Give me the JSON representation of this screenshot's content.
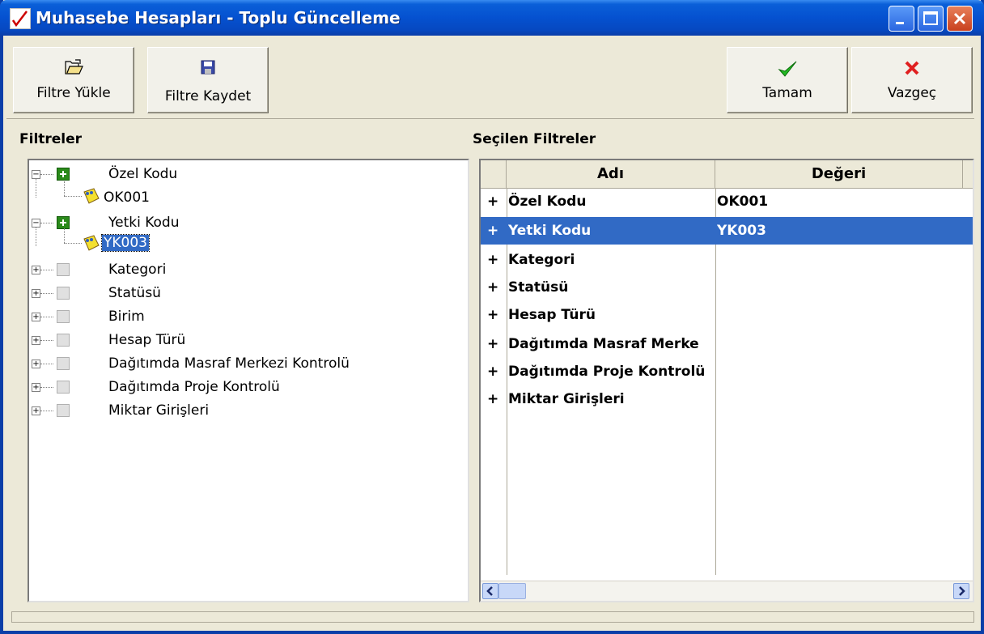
{
  "window": {
    "title": "Muhasebe Hesapları - Toplu Güncelleme",
    "accent": "#0a5fd8",
    "selection_color": "#316ac5"
  },
  "toolbar": {
    "load_filter_label": "Filtre Yükle",
    "save_filter_label": "Filtre Kaydet",
    "ok_label": "Tamam",
    "cancel_label": "Vazgeç"
  },
  "filters_panel": {
    "title": "Filtreler",
    "tree": [
      {
        "label": "Özel Kodu",
        "expanded": true,
        "checked": true,
        "children": [
          "OK001"
        ]
      },
      {
        "label": "Yetki Kodu",
        "expanded": true,
        "checked": true,
        "children": [
          "YK003"
        ]
      },
      {
        "label": "Kategori",
        "expanded": false,
        "checked": false
      },
      {
        "label": "Statüsü",
        "expanded": false,
        "checked": false
      },
      {
        "label": "Birim",
        "expanded": false,
        "checked": false
      },
      {
        "label": "Hesap Türü",
        "expanded": false,
        "checked": false
      },
      {
        "label": "Dağıtımda Masraf Merkezi Kontrolü",
        "expanded": false,
        "checked": false
      },
      {
        "label": "Dağıtımda Proje Kontrolü",
        "expanded": false,
        "checked": false
      },
      {
        "label": "Miktar Girişleri",
        "expanded": false,
        "checked": false
      }
    ]
  },
  "selected_panel": {
    "title": "Seçilen Filtreler",
    "columns": [
      "Adı",
      "Değeri"
    ],
    "rows": [
      {
        "expander": "+",
        "name": "Özel Kodu",
        "value": "OK001"
      },
      {
        "expander": "+",
        "name": "Yetki Kodu",
        "value": "YK003"
      },
      {
        "expander": "+",
        "name": "Kategori",
        "value": ""
      },
      {
        "expander": "+",
        "name": "Statüsü",
        "value": ""
      },
      {
        "expander": "+",
        "name": "Hesap Türü",
        "value": ""
      },
      {
        "expander": "+",
        "name": "Dağıtımda Masraf Merke",
        "value": ""
      },
      {
        "expander": "+",
        "name": "Dağıtımda Proje Kontrolü",
        "value": ""
      },
      {
        "expander": "+",
        "name": "Miktar Girişleri",
        "value": ""
      }
    ]
  }
}
